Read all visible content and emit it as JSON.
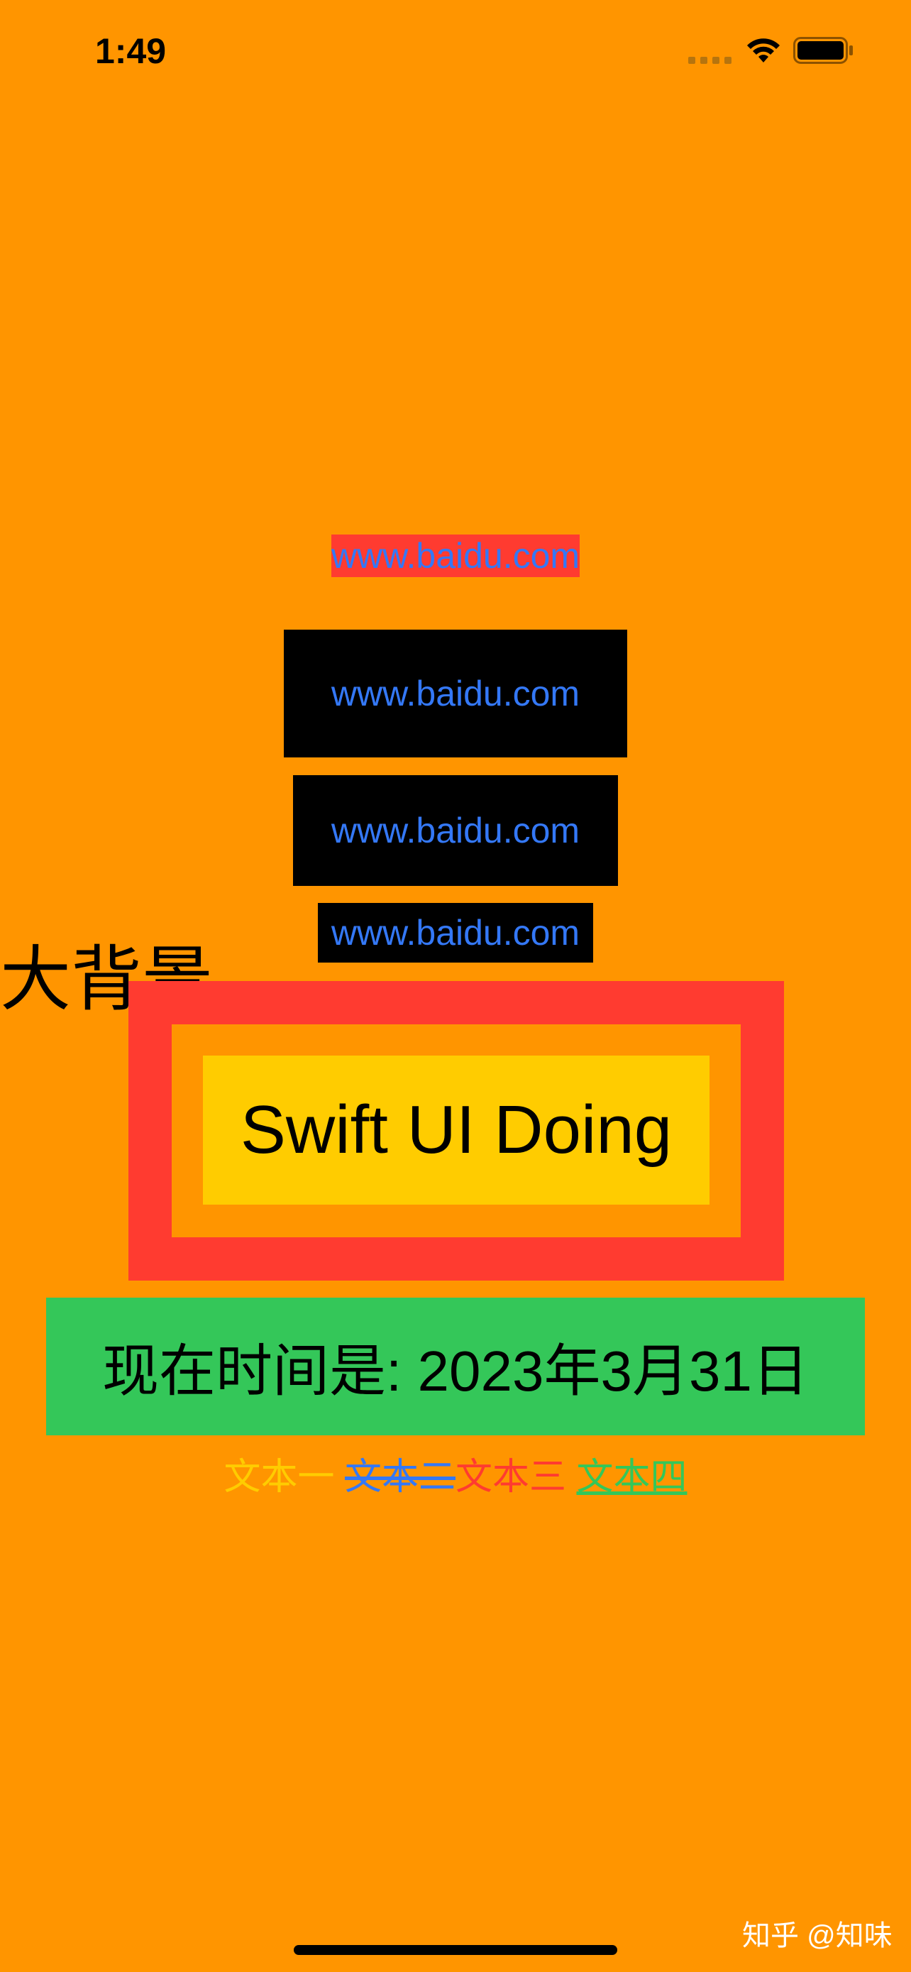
{
  "status_bar": {
    "time": "1:49",
    "icons": [
      "signal-icon",
      "wifi-icon",
      "battery-icon"
    ]
  },
  "links": {
    "link1": "www.baidu.com",
    "link2": "www.baidu.com",
    "link3": "www.baidu.com",
    "link4": "www.baidu.com"
  },
  "background_label": "大背景",
  "swift_box": {
    "text": "Swift UI Doing"
  },
  "date_box": {
    "text": "现在时间是: 2023年3月31日"
  },
  "styled_texts": {
    "t1": "文本一 ",
    "t2": "文本二",
    "t3": "文本三 ",
    "t4": "文本四"
  },
  "watermark": "知乎 @知味",
  "colors": {
    "background": "#FF9500",
    "red": "#FF3B30",
    "blue": "#3478F6",
    "yellow": "#FFCC00",
    "green": "#34C759",
    "black": "#000000"
  }
}
